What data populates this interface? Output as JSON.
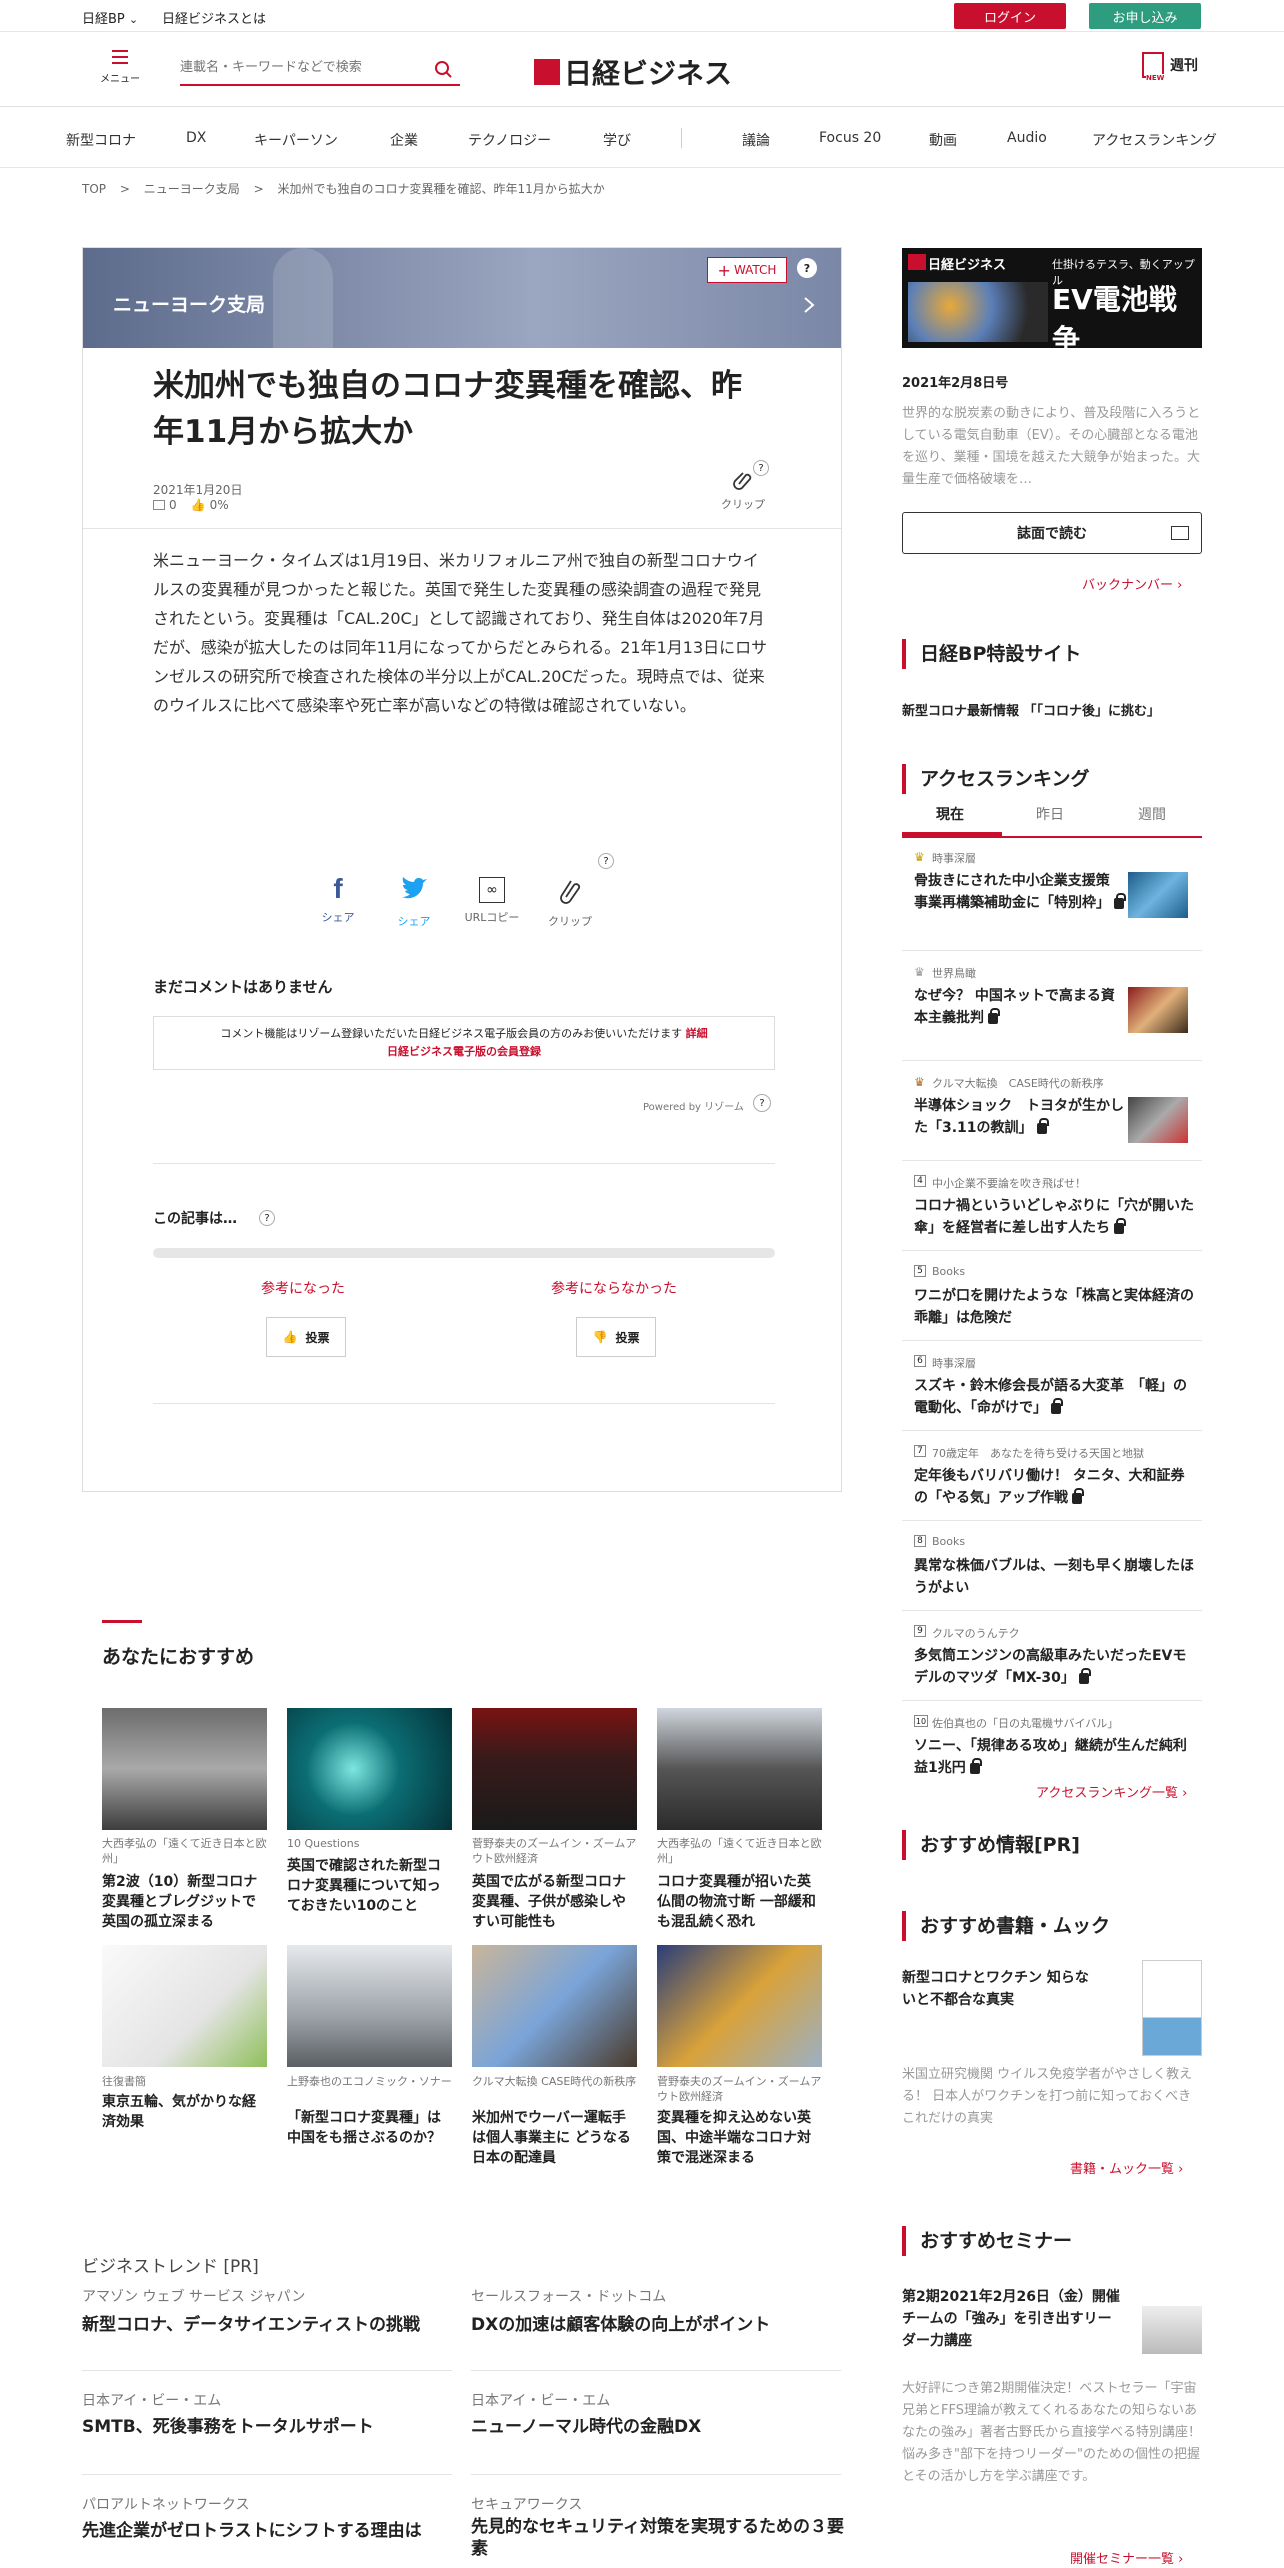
{
  "topbar": {
    "site": "日経BP",
    "site_caret": "⌄",
    "about": "日経ビジネスとは",
    "login": "ログイン",
    "apply": "お申し込み"
  },
  "header": {
    "menu_label": "メニュー",
    "search_placeholder": "連載名・キーワードなどで検索",
    "logo": "日経ビジネス",
    "weekly_badge": "NEW",
    "weekly": "週刊"
  },
  "nav": [
    "新型コロナ",
    "DX",
    "キーパーソン",
    "企業",
    "テクノロジー",
    "学び",
    "議論",
    "Focus 20",
    "動画",
    "Audio",
    "アクセスランキング"
  ],
  "breadcrumb": {
    "top": "TOP",
    "sep": ">",
    "section": "ニューヨーク支局",
    "current": "米加州でも独自のコロナ変異種を確認、昨年11月から拡大か"
  },
  "article": {
    "banner_title": "ニューヨーク支局",
    "watch": "WATCH",
    "help": "?",
    "title": "米加州でも独自のコロナ変異種を確認、昨年11月から拡大か",
    "date": "2021年1月20日",
    "comments": "0",
    "likes": "0%",
    "clip": "クリップ",
    "body": "米ニューヨーク・タイムズは1月19日、米カリフォルニア州で独自の新型コロナウイルスの変異種が見つかったと報じた。英国で発生した変異種の感染調査の過程で発見されたという。変異種は「CAL.20C」として認識されており、発生自体は2020年7月だが、感染が拡大したのは同年11月になってからだとみられる。21年1月13日にロサンゼルスの研究所で検査された検体の半分以上がCAL.20Cだった。現時点では、従来のウイルスに比べて感染率や死亡率が高いなどの特徴は確認されていない。",
    "share": {
      "facebook": "シェア",
      "twitter": "シェア",
      "url": "URLコピー",
      "clip": "クリップ"
    },
    "no_comments": "まだコメントはありません",
    "comment_notice": "コメント機能はリゾーム登録いただいた日経ビジネス電子版会員の方のみお使いいただけます",
    "comment_detail": "詳細",
    "comment_register": "日経ビジネス電子版の会員登録",
    "powered": "Powered by リゾーム",
    "survey_title": "この記事は…",
    "helpful": "参考になった",
    "not_helpful": "参考にならなかった",
    "vote": "投票"
  },
  "sidebar": {
    "ad": {
      "logo": "日経ビジネス",
      "sub": "仕掛けるテスラ、動くアップル",
      "headline": "EV電池戦争"
    },
    "issue_date": "2021年2月8日号",
    "issue_desc": "世界的な脱炭素の動きにより、普及段階に入ろうとしている電気自動車（EV）。その心臓部となる電池を巡り、業種・国境を越えた大競争が始まった。大量生産で価格破壊を…",
    "read_issue": "誌面で読む",
    "backnumber": "バックナンバー",
    "special_title": "日経BP特設サイト",
    "special_item": "新型コロナ最新情報 「「コロナ後」に挑む」",
    "ranking_title": "アクセスランキング",
    "ranking_tabs": [
      "現在",
      "昨日",
      "週間"
    ],
    "ranking": [
      {
        "rank": "1",
        "cat": "時事深層",
        "title": "骨抜きにされた中小企業支援策　事業再構築補助金に「特別枠」"
      },
      {
        "rank": "2",
        "cat": "世界鳥瞰",
        "title": "なぜ今？ 中国ネットで高まる資本主義批判"
      },
      {
        "rank": "3",
        "cat": "クルマ大転換　CASE時代の新秩序",
        "title": "半導体ショック　トヨタが生かした「3.11の教訓」"
      },
      {
        "rank": "4",
        "cat": "中小企業不要論を吹き飛ばせ！",
        "title": "コロナ禍といういどしゃぶりに「穴が開いた傘」を経営者に差し出す人たち"
      },
      {
        "rank": "5",
        "cat": "Books",
        "title": "ワニが口を開けたような「株高と実体経済の乖離」は危険だ"
      },
      {
        "rank": "6",
        "cat": "時事深層",
        "title": "スズキ・鈴木修会長が語る大変革　「軽」の電動化、「命がけで」"
      },
      {
        "rank": "7",
        "cat": "70歳定年　あなたを待ち受ける天国と地獄",
        "title": "定年後もバリバリ働け！ タニタ、大和証券の「やる気」アップ作戦"
      },
      {
        "rank": "8",
        "cat": "Books",
        "title": "異常な株価バブルは、一刻も早く崩壊したほうがよい"
      },
      {
        "rank": "9",
        "cat": "クルマのうんテク",
        "title": "多気筒エンジンの高級車みたいだったEVモデルのマツダ「MX-30」"
      },
      {
        "rank": "10",
        "cat": "佐伯真也の「日の丸電機サバイバル」",
        "title": "ソニー、「規律ある攻め」継続が生んだ純利益1兆円"
      }
    ],
    "ranking_more": "アクセスランキング一覧",
    "pr_title": "おすすめ情報[PR]",
    "books_title": "おすすめ書籍・ムック",
    "book_name": "新型コロナとワクチン 知らないと不都合な真実",
    "book_desc": "米国立研究機関 ウイルス免疫学者がやさしく教える！ 日本人がワクチンを打つ前に知っておくべきこれだけの真実",
    "books_more": "書籍・ムック一覧",
    "seminar_title": "おすすめセミナー",
    "seminar_name": "第2期2021年2月26日（金）開催 チームの「強み」を引き出すリーダー力講座",
    "seminar_desc": "大好評につき第2期開催決定！ベストセラー「宇宙兄弟とFFS理論が教えてくれるあなたの知らないあなたの強み」著者古野氏から直接学べる特別講座！ 悩み多き\"部下を持つリーダー\"のための個性の把握とその活かし方を学ぶ講座です。",
    "seminar_more": "開催セミナー一覧"
  },
  "recommend": {
    "title": "あなたにおすすめ",
    "items": [
      {
        "cat": "大西孝弘の「遠くて近き日本と欧州」",
        "title": "第2波（10）新型コロナ変異種とブレグジットで英国の孤立深まる"
      },
      {
        "cat": "10 Questions",
        "title": "英国で確認された新型コロナ変異種について知っておきたい10のこと"
      },
      {
        "cat": "菅野泰夫のズームイン・ズームアウト欧州経済",
        "title": "英国で広がる新型コロナ変異種、子供が感染しやすい可能性も"
      },
      {
        "cat": "大西孝弘の「遠くて近き日本と欧州」",
        "title": "コロナ変異種が招いた英仏間の物流寸断 一部緩和も混乱続く恐れ"
      },
      {
        "cat": "往復書簡",
        "title": "東京五輪、気がかりな経済効果"
      },
      {
        "cat": "上野泰也のエコノミック・ソナー",
        "title": "「新型コロナ変異種」は中国をも揺さぶるのか？"
      },
      {
        "cat": "クルマ大転換 CASE時代の新秩序",
        "title": "米加州でウーバー運転手は個人事業主に どうなる日本の配達員"
      },
      {
        "cat": "菅野泰夫のズームイン・ズームアウト欧州経済",
        "title": "変異種を抑え込めない英国、中途半端なコロナ対策で混迷深まる"
      }
    ]
  },
  "trend": {
    "title": "ビジネストレンド [PR]",
    "items": [
      {
        "cat": "アマゾン ウェブ サービス ジャパン",
        "title": "新型コロナ、データサイエンティストの挑戦"
      },
      {
        "cat": "セールスフォース・ドットコム",
        "title": "DXの加速は顧客体験の向上がポイント"
      },
      {
        "cat": "日本アイ・ビー・エム",
        "title": "SMTB、死後事務をトータルサポート"
      },
      {
        "cat": "日本アイ・ビー・エム",
        "title": "ニューノーマル時代の金融DX"
      },
      {
        "cat": "パロアルトネットワークス",
        "title": "先進企業がゼロトラストにシフトする理由は"
      },
      {
        "cat": "セキュアワークス",
        "title": "先見的なセキュリティ対策を実現するための３要素"
      }
    ]
  },
  "colors": {
    "accent": "#c8102e",
    "apply": "#2e9c7f"
  }
}
